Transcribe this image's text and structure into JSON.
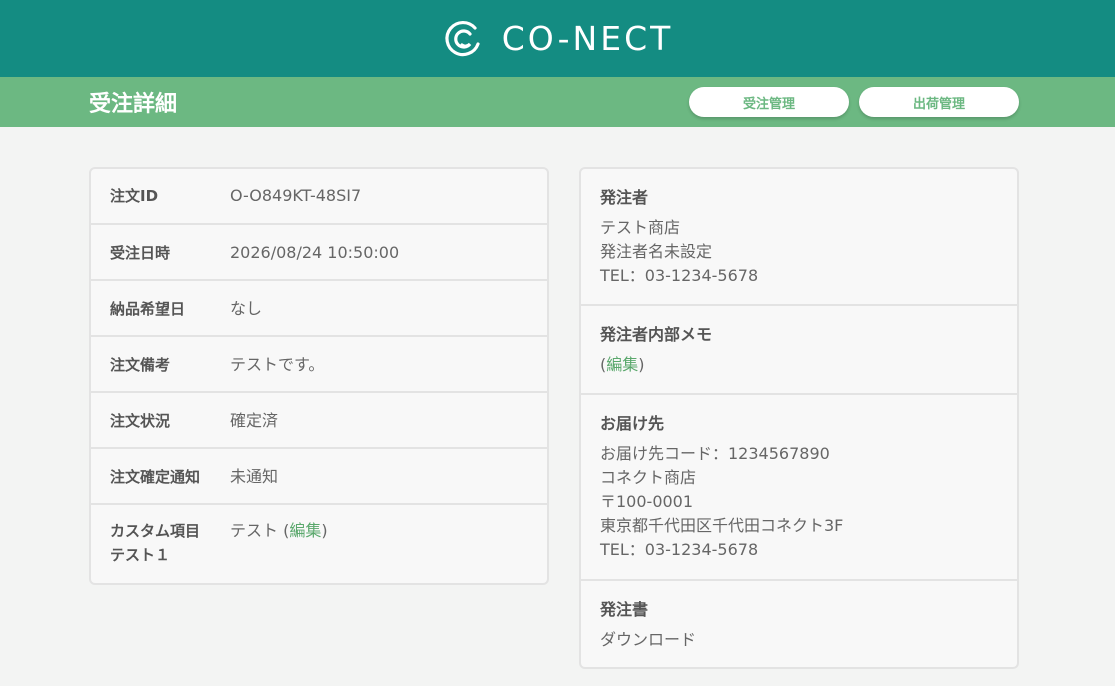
{
  "header": {
    "logo_text": "CO-NECT",
    "brand_color": "#148c82",
    "accent_color": "#6cb882"
  },
  "subheader": {
    "title": "受注詳細",
    "buttons": [
      "受注管理",
      "出荷管理"
    ]
  },
  "order": {
    "rows": [
      {
        "label": "注文ID",
        "value": "O-O849KT-48SI7"
      },
      {
        "label": "受注日時",
        "value": "2026/08/24 10:50:00"
      },
      {
        "label": "納品希望日",
        "value": "なし"
      },
      {
        "label": "注文備考",
        "value": "テストです。"
      },
      {
        "label": "注文状況",
        "value": "確定済"
      },
      {
        "label": "注文確定通知",
        "value": "未通知"
      }
    ],
    "custom": {
      "label_line1": "カスタム項目",
      "label_line2": "テスト１",
      "value": "テスト",
      "open_paren": "(",
      "edit_link": "編集",
      "close_paren": ")"
    }
  },
  "orderer": {
    "title": "発注者",
    "lines": [
      "テスト商店",
      "発注者名未設定",
      "TEL：03-1234-5678"
    ]
  },
  "memo": {
    "title": "発注者内部メモ",
    "open_paren": "(",
    "edit_link": "編集",
    "close_paren": ")"
  },
  "delivery": {
    "title": "お届け先",
    "lines": [
      "お届け先コード：1234567890",
      "コネクト商店",
      "〒100-0001",
      "東京都千代田区千代田コネクト3F",
      "TEL：03-1234-5678"
    ]
  },
  "po": {
    "title": "発注書",
    "download_link": "ダウンロード"
  }
}
